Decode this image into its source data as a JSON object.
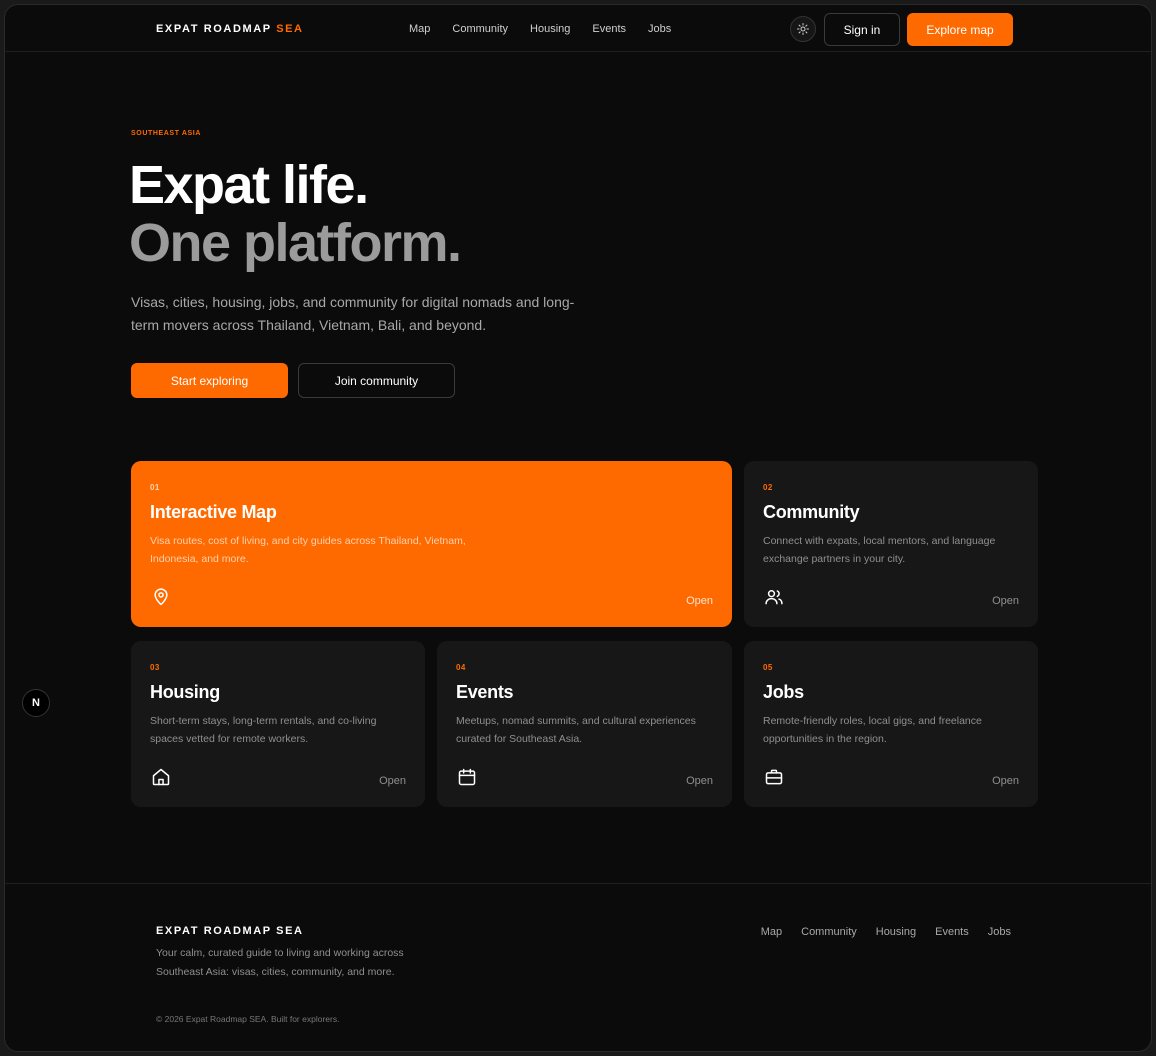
{
  "header": {
    "brand_main": "EXPAT ROADMAP",
    "brand_accent": "SEA",
    "nav": [
      "Map",
      "Community",
      "Housing",
      "Events",
      "Jobs"
    ],
    "theme_icon": "sun-icon",
    "signin_label": "Sign in",
    "explore_label": "Explore map"
  },
  "hero": {
    "eyebrow": "SOUTHEAST ASIA",
    "title_line1": "Expat life.",
    "title_line2": "One platform.",
    "lead": "Visas, cities, housing, jobs, and community for digital nomads and long-term movers across Thailand, Vietnam, Bali, and beyond.",
    "primary_cta": "Start exploring",
    "secondary_cta": "Join community"
  },
  "cards": [
    {
      "num": "01",
      "title": "Interactive Map",
      "desc": "Visa routes, cost of living, and city guides across Thailand, Vietnam, Indonesia, and more.",
      "icon": "map-pin-icon",
      "open": "Open"
    },
    {
      "num": "02",
      "title": "Community",
      "desc": "Connect with expats, local mentors, and language exchange partners in your city.",
      "icon": "users-icon",
      "open": "Open"
    },
    {
      "num": "03",
      "title": "Housing",
      "desc": "Short-term stays, long-term rentals, and co-living spaces vetted for remote workers.",
      "icon": "home-icon",
      "open": "Open"
    },
    {
      "num": "04",
      "title": "Events",
      "desc": "Meetups, nomad summits, and cultural experiences curated for Southeast Asia.",
      "icon": "calendar-icon",
      "open": "Open"
    },
    {
      "num": "05",
      "title": "Jobs",
      "desc": "Remote-friendly roles, local gigs, and freelance opportunities in the region.",
      "icon": "briefcase-icon",
      "open": "Open"
    }
  ],
  "badge": "N",
  "footer": {
    "brand": "EXPAT ROADMAP SEA",
    "desc": "Your calm, curated guide to living and working across Southeast Asia: visas, cities, community, and more.",
    "nav": [
      "Map",
      "Community",
      "Housing",
      "Events",
      "Jobs"
    ],
    "copyright": "© 2026 Expat Roadmap SEA. Built for explorers."
  },
  "colors": {
    "accent": "#ff6a00",
    "background": "#0b0b0b",
    "card": "#171717"
  }
}
